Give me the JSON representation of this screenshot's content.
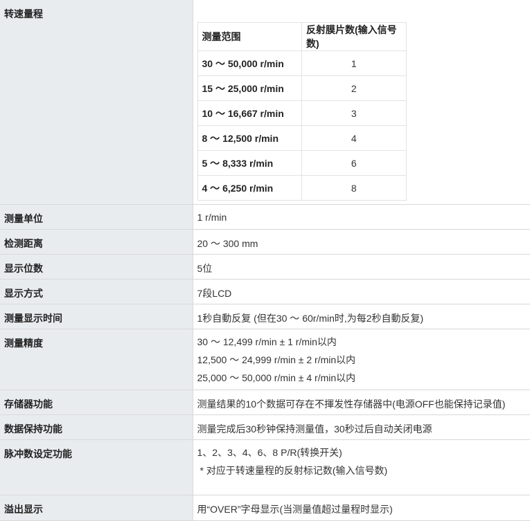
{
  "rows": {
    "speed_range": {
      "label": "转速量程",
      "table": {
        "header_range": "测量范围",
        "header_count": "反射膜片数(输入信号数)",
        "rows": [
          {
            "range": "30 ～ 50,000 r/min",
            "count": "1"
          },
          {
            "range": "15 ～ 25,000 r/min",
            "count": "2"
          },
          {
            "range": "10 ～ 16,667 r/min",
            "count": "3"
          },
          {
            "range": "8 ～ 12,500 r/min",
            "count": "4"
          },
          {
            "range": "5 ～ 8,333 r/min",
            "count": "6"
          },
          {
            "range": "4 ～ 6,250 r/min",
            "count": "8"
          }
        ]
      }
    },
    "unit": {
      "label": "测量单位",
      "value": "1 r/min"
    },
    "distance": {
      "label": "检测距离",
      "value": "20 ～ 300 mm"
    },
    "digits": {
      "label": "显示位数",
      "value": "5位"
    },
    "display_mode": {
      "label": "显示方式",
      "value": "7段LCD"
    },
    "display_time": {
      "label": "测量显示时间",
      "value": "1秒自動反复 (但在30 ～ 60r/min时,为每2秒自動反复)"
    },
    "accuracy": {
      "label": "测量精度",
      "lines": [
        "30 ～ 12,499 r/min ± 1 r/min以内",
        "12,500 ～ 24,999 r/min ± 2 r/min以内",
        "25,000 ～ 50,000 r/min ± 4 r/min以内"
      ]
    },
    "memory": {
      "label": "存储器功能",
      "value": "测量结果的10个数据可存在不揮发性存储器中(电源OFF也能保持记录值)"
    },
    "hold": {
      "label": "数据保持功能",
      "value": "测量完成后30秒钟保持测量值，30秒过后自动关闭电源"
    },
    "pulse": {
      "label": "脉冲数设定功能",
      "value": "1、2、3、4、6、8 P/R(转换开关)",
      "note": "* 对应于转速量程的反射标记数(输入信号数)"
    },
    "overflow": {
      "label": "溢出显示",
      "value": "用“OVER”字母显示(当测量值超过量程时显示)"
    }
  }
}
